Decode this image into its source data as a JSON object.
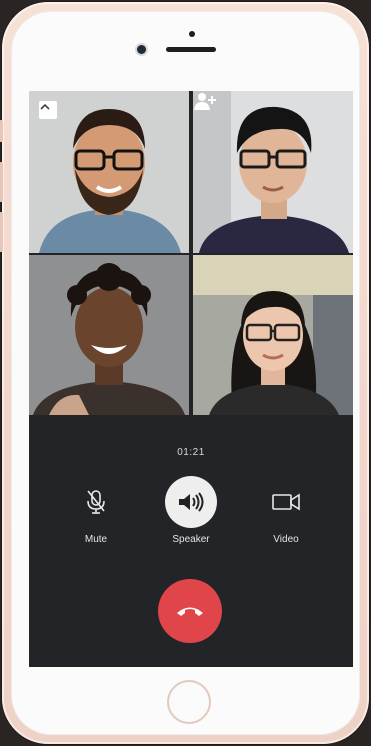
{
  "call": {
    "timer": "01:21",
    "controls": {
      "mute_label": "Mute",
      "speaker_label": "Speaker",
      "video_label": "Video"
    }
  },
  "participants": [
    {
      "slot": 1,
      "icon": "man-bearded-glasses"
    },
    {
      "slot": 2,
      "icon": "man-glasses"
    },
    {
      "slot": 3,
      "icon": "woman-short-hair"
    },
    {
      "slot": 4,
      "icon": "woman-glasses"
    }
  ],
  "icons": {
    "collapse": "chevron-up-icon",
    "add_participant": "add-user-icon",
    "mute": "microphone-icon",
    "speaker": "speaker-icon",
    "video": "video-camera-icon",
    "end_call": "hang-up-icon"
  },
  "colors": {
    "end_call": "#e0454a",
    "call_background": "#232427",
    "speaker_active": "#eeeeee"
  }
}
